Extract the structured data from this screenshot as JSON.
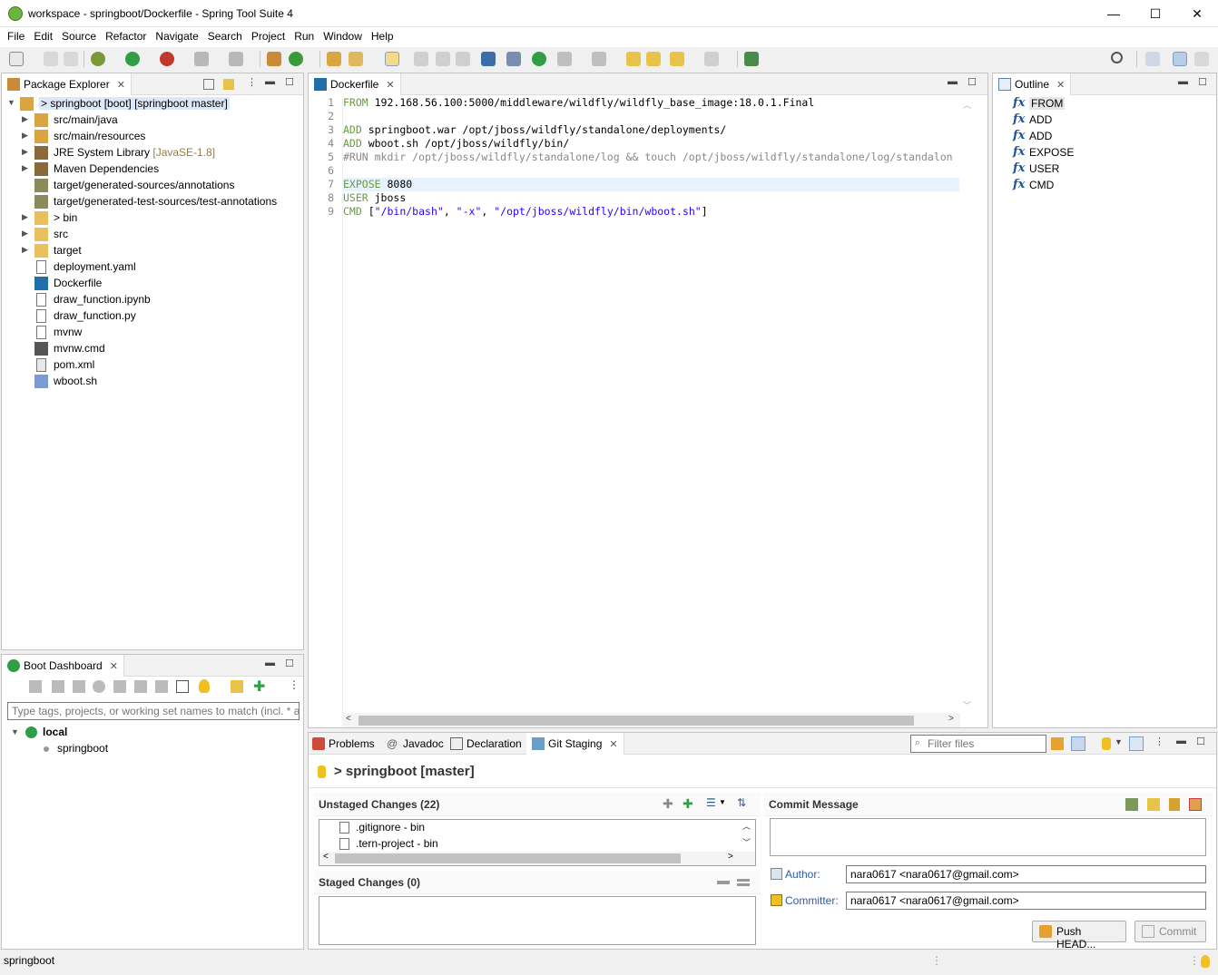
{
  "window": {
    "title": "workspace - springboot/Dockerfile - Spring Tool Suite 4",
    "min": "—",
    "max": "☐",
    "close": "✕"
  },
  "menu": [
    "File",
    "Edit",
    "Source",
    "Refactor",
    "Navigate",
    "Search",
    "Project",
    "Run",
    "Window",
    "Help"
  ],
  "package_explorer": {
    "tab": "Package Explorer",
    "items": [
      {
        "label": "> springboot [boot] [springboot master]",
        "extra": "",
        "depth": 0,
        "expanded": true,
        "icon": "project-icon"
      },
      {
        "label": "src/main/java",
        "extra": "",
        "depth": 1,
        "icon": "source-folder-icon"
      },
      {
        "label": "src/main/resources",
        "extra": "",
        "depth": 1,
        "icon": "source-folder-icon"
      },
      {
        "label": "JRE System Library ",
        "extra": "[JavaSE-1.8]",
        "depth": 1,
        "icon": "library-icon"
      },
      {
        "label": "Maven Dependencies",
        "extra": "",
        "depth": 1,
        "icon": "library-icon"
      },
      {
        "label": "target/generated-sources/annotations",
        "extra": "",
        "depth": 1,
        "icon": "package-folder-icon",
        "noarrow": true
      },
      {
        "label": "target/generated-test-sources/test-annotations",
        "extra": "",
        "depth": 1,
        "icon": "package-folder-icon",
        "noarrow": true
      },
      {
        "label": "> bin",
        "extra": "",
        "depth": 1,
        "icon": "folder-icon"
      },
      {
        "label": "src",
        "extra": "",
        "depth": 1,
        "icon": "folder-icon"
      },
      {
        "label": "target",
        "extra": "",
        "depth": 1,
        "icon": "folder-icon"
      },
      {
        "label": "deployment.yaml",
        "extra": "",
        "depth": 1,
        "icon": "file-icon",
        "noarrow": true
      },
      {
        "label": "Dockerfile",
        "extra": "",
        "depth": 1,
        "icon": "docker-icon",
        "noarrow": true
      },
      {
        "label": "draw_function.ipynb",
        "extra": "",
        "depth": 1,
        "icon": "file-icon",
        "noarrow": true
      },
      {
        "label": "draw_function.py",
        "extra": "",
        "depth": 1,
        "icon": "file-icon",
        "noarrow": true
      },
      {
        "label": "mvnw",
        "extra": "",
        "depth": 1,
        "icon": "file-icon",
        "noarrow": true
      },
      {
        "label": "mvnw.cmd",
        "extra": "",
        "depth": 1,
        "icon": "cmd-icon",
        "noarrow": true
      },
      {
        "label": "pom.xml",
        "extra": "",
        "depth": 1,
        "icon": "xml-icon",
        "noarrow": true
      },
      {
        "label": "wboot.sh",
        "extra": "",
        "depth": 1,
        "icon": "script-icon",
        "noarrow": true
      }
    ]
  },
  "editor": {
    "tab": "Dockerfile",
    "line_numbers": [
      "1",
      "2",
      "3",
      "4",
      "5",
      "6",
      "7",
      "8",
      "9"
    ],
    "lines": [
      [
        {
          "t": "FROM ",
          "c": "kw"
        },
        {
          "t": "192.168.56.100:5000/middleware/wildfly/wildfly_base_image:18.0.1.Final",
          "c": ""
        }
      ],
      [],
      [
        {
          "t": "ADD ",
          "c": "kw"
        },
        {
          "t": "springboot.war /opt/jboss/wildfly/standalone/deployments/",
          "c": ""
        }
      ],
      [
        {
          "t": "ADD ",
          "c": "kw"
        },
        {
          "t": "wboot.sh /opt/jboss/wildfly/bin/",
          "c": ""
        }
      ],
      [
        {
          "t": "#RUN mkdir /opt/jboss/wildfly/standalone/log && touch /opt/jboss/wildfly/standalone/log/standalon",
          "c": "cmt"
        }
      ],
      [],
      [
        {
          "t": "EXPOSE ",
          "c": "kw"
        },
        {
          "t": "8080",
          "c": ""
        }
      ],
      [
        {
          "t": "USER ",
          "c": "kw"
        },
        {
          "t": "jboss",
          "c": ""
        }
      ],
      [
        {
          "t": "CMD ",
          "c": "kw"
        },
        {
          "t": "[",
          "c": ""
        },
        {
          "t": "\"/bin/bash\"",
          "c": "str"
        },
        {
          "t": ", ",
          "c": ""
        },
        {
          "t": "\"-x\"",
          "c": "str"
        },
        {
          "t": ", ",
          "c": ""
        },
        {
          "t": "\"/opt/jboss/wildfly/bin/wboot.sh\"",
          "c": "str"
        },
        {
          "t": "]",
          "c": ""
        }
      ]
    ]
  },
  "outline": {
    "tab": "Outline",
    "items": [
      "FROM",
      "ADD",
      "ADD",
      "EXPOSE",
      "USER",
      "CMD"
    ]
  },
  "boot_dashboard": {
    "tab": "Boot Dashboard",
    "filter_placeholder": "Type tags, projects, or working set names to match (incl. * and ? wildcards)",
    "local": "local",
    "app": "springboot"
  },
  "bottom_tabs": {
    "problems": "Problems",
    "javadoc": "Javadoc",
    "declaration": "Declaration",
    "git_staging": "Git Staging",
    "filter_placeholder": "Filter files"
  },
  "git": {
    "repo": "> springboot [master]",
    "unstaged_title": "Unstaged Changes (22)",
    "unstaged_files": [
      ".gitignore - bin",
      ".tern-project - bin"
    ],
    "staged_title": "Staged Changes (0)",
    "commit_message_title": "Commit Message",
    "author_label": "Author:",
    "author_value": "nara0617 <nara0617@gmail.com>",
    "committer_label": "Committer:",
    "committer_value": "nara0617 <nara0617@gmail.com>",
    "push_button": "Push HEAD...",
    "commit_button": "Commit"
  },
  "status_bar": {
    "text": "springboot"
  }
}
